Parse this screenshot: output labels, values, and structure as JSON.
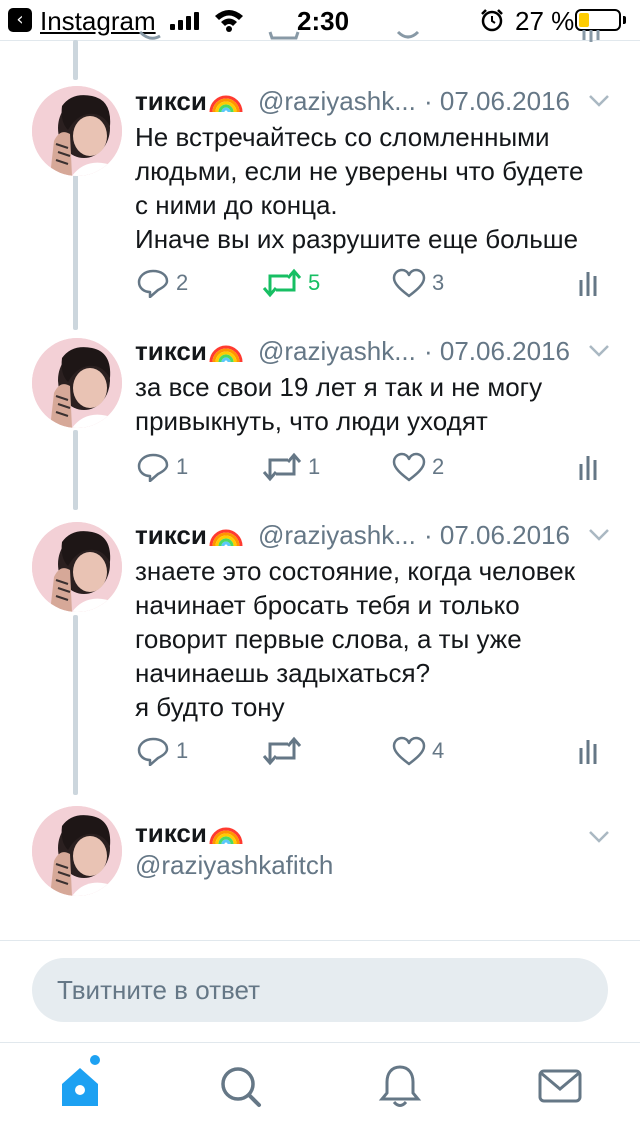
{
  "status_bar": {
    "back_app": "Instagram",
    "time": "2:30",
    "battery": "27 %",
    "battery_level": 0.27
  },
  "tweets": [
    {
      "name": "тикси",
      "handle": "@raziyashk...",
      "date": "· 07.06.2016",
      "text": "Не встречайтесь со сломленными\nлюдьми, если не уверены что будете\nс ними до конца.\nИначе вы их разрушите еще больше",
      "replies": "2",
      "retweets": "5",
      "likes": "3",
      "retweeted": true
    },
    {
      "name": "тикси",
      "handle": "@raziyashk...",
      "date": "· 07.06.2016",
      "text": "за все свои 19 лет я так и не могу\nпривыкнуть, что люди уходят",
      "replies": "1",
      "retweets": "1",
      "likes": "2",
      "retweeted": false
    },
    {
      "name": "тикси",
      "handle": "@raziyashk...",
      "date": "· 07.06.2016",
      "text": "знаете это состояние, когда человек\nначинает бросать тебя и только\nговорит первые слова, а ты уже\nначинаешь задыхаться?\nя будто тону",
      "replies": "1",
      "retweets": "",
      "likes": "4",
      "retweeted": false
    }
  ],
  "main_tweet": {
    "name": "тикси",
    "handle": "@raziyashkafitch"
  },
  "reply": {
    "placeholder": "Твитните в ответ"
  },
  "tab_bar": [
    "home-icon",
    "search-icon",
    "notifications-icon",
    "messages-icon"
  ],
  "colors": {
    "accent": "#1da1f2",
    "retweet_green": "#17bf63",
    "secondary_text": "#657786",
    "thread_line": "#ccd6dd"
  }
}
